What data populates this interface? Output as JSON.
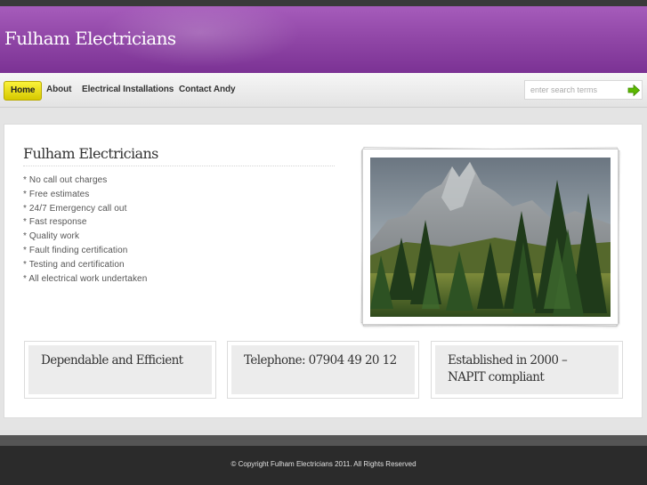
{
  "header": {
    "site_title": "Fulham Electricians"
  },
  "nav": {
    "items": [
      {
        "label": "Home",
        "active": true
      },
      {
        "label": "About",
        "active": false
      },
      {
        "label": "Electrical Installations",
        "active": false
      },
      {
        "label": "Contact Andy",
        "active": false
      }
    ]
  },
  "search": {
    "placeholder": "enter search terms",
    "go_icon": "arrow-right-icon"
  },
  "content": {
    "title": "Fulham Electricians",
    "features": [
      "* No call out charges",
      "* Free estimates",
      "* 24/7 Emergency call out",
      "* Fast response",
      "* Quality work",
      "* Fault finding certification",
      "* Testing and certification",
      "* All electrical work undertaken"
    ]
  },
  "boxes": [
    {
      "text": "Dependable and Efficient"
    },
    {
      "text": "Telephone: 07904 49 20 12"
    },
    {
      "text": "Established in 2000 – NAPIT compliant"
    }
  ],
  "footer": {
    "text": "© Copyright Fulham Electricians 2011. All Rights Reserved"
  },
  "colors": {
    "header": "#9248a8",
    "active_nav": "#e8dc10",
    "footer": "#2b2b2b"
  }
}
